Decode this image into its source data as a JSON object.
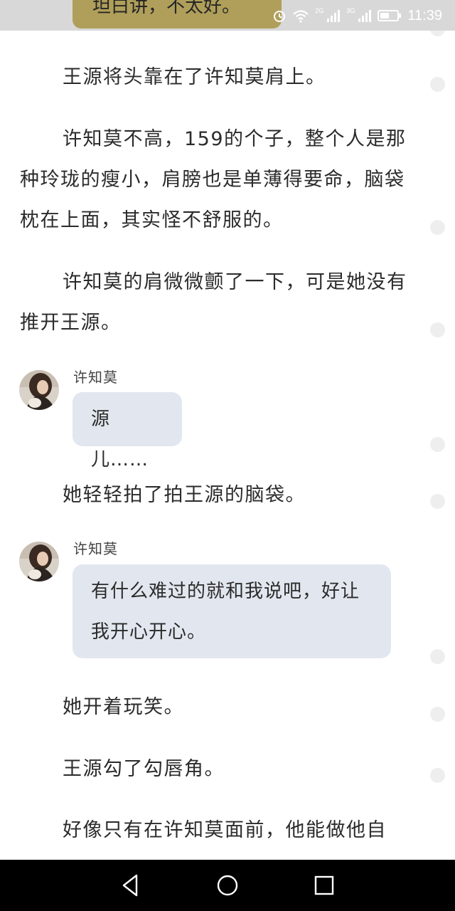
{
  "status_bar": {
    "top_bubble_text": "坦白讲，不太好。",
    "net_label_1": "2G",
    "net_label_2": "3G",
    "time": "11:39"
  },
  "story": {
    "p1": "王源将头靠在了许知莫肩上。",
    "p2": "许知莫不高，159的个子，整个人是那种玲珑的瘦小，肩膀也是单薄得要命，脑袋枕在上面，其实怪不舒服的。",
    "p3": "许知莫的肩微微颤了一下，可是她没有推开王源。",
    "p4": "她轻轻拍了拍王源的脑袋。",
    "p5": "她开着玩笑。",
    "p6": "王源勾了勾唇角。",
    "p7": "好像只有在许知莫面前，他能做他自"
  },
  "chat": [
    {
      "speaker": "许知莫",
      "message": "源儿……"
    },
    {
      "speaker": "许知莫",
      "message": "有什么难过的就和我说吧，好让我开心开心。"
    }
  ],
  "nav": {
    "back_icon": "triangle-back-icon",
    "home_icon": "circle-home-icon",
    "recents_icon": "square-recents-icon"
  },
  "colors": {
    "status_bar": "#d8d8d8",
    "top_bubble": "#b09f5a",
    "chat_bubble": "#e2e7ef",
    "nav_bar": "#000000"
  }
}
